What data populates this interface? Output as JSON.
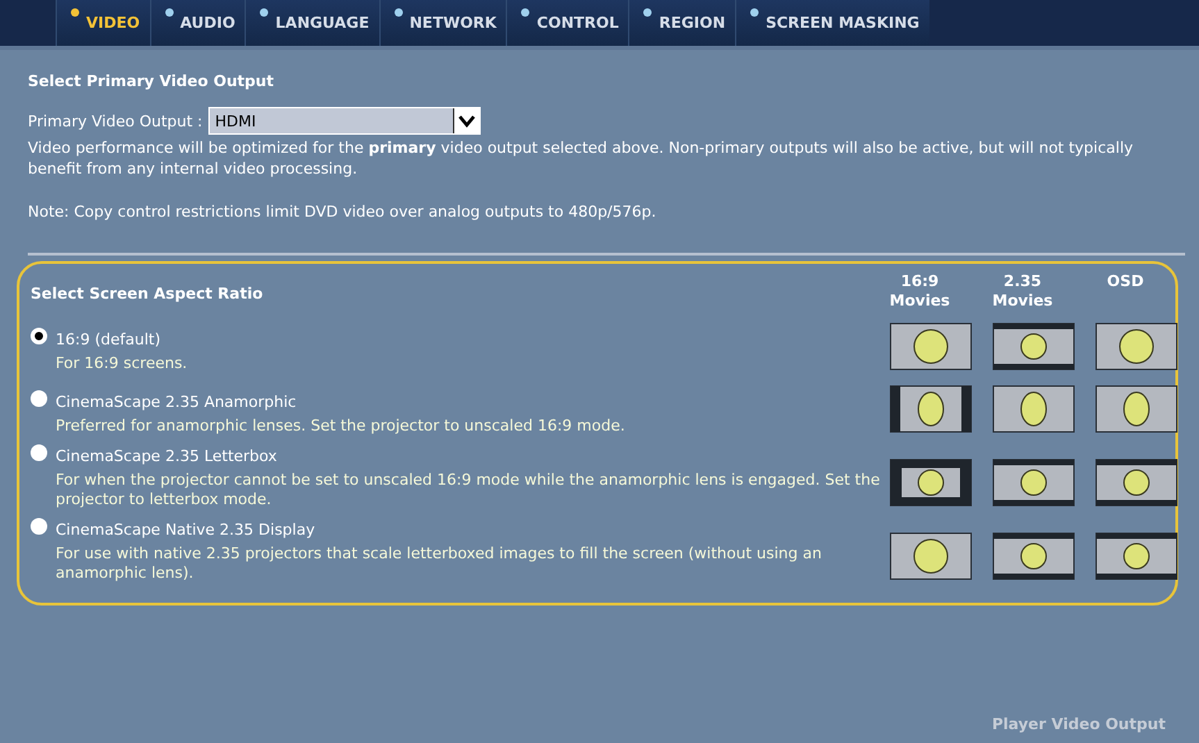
{
  "tabs": [
    {
      "label": "VIDEO",
      "selected": true
    },
    {
      "label": "AUDIO",
      "selected": false
    },
    {
      "label": "LANGUAGE",
      "selected": false
    },
    {
      "label": "NETWORK",
      "selected": false
    },
    {
      "label": "CONTROL",
      "selected": false
    },
    {
      "label": "REGION",
      "selected": false
    },
    {
      "label": "SCREEN MASKING",
      "selected": false
    }
  ],
  "primary": {
    "heading": "Select Primary Video Output",
    "label": "Primary Video Output :",
    "value": "HDMI",
    "description": "Video performance will be optimized for the **primary** video output selected above. Non-primary outputs will also be active, but will not typically benefit from any internal video processing.",
    "note": "Note: Copy control restrictions limit DVD video over analog outputs to 480p/576p."
  },
  "aspect": {
    "heading": "Select Screen Aspect Ratio",
    "columns": [
      {
        "line1": "16:9",
        "line2": "Movies"
      },
      {
        "line1": "2.35",
        "line2": "Movies"
      },
      {
        "line2": "OSD"
      }
    ],
    "options": [
      {
        "label": "16:9 (default)",
        "description": "For 16:9 screens.",
        "selected": true,
        "previews": [
          {
            "kind": "fullscreen"
          },
          {
            "kind": "letterbox"
          },
          {
            "kind": "fullscreen"
          }
        ]
      },
      {
        "label": "CinemaScape 2.35 Anamorphic",
        "description": "Preferred for anamorphic lenses. Set the projector to unscaled 16:9 mode.",
        "selected": false,
        "previews": [
          {
            "kind": "pillarbox"
          },
          {
            "kind": "anamorphic"
          },
          {
            "kind": "anamorphic"
          }
        ]
      },
      {
        "label": "CinemaScape 2.35 Letterbox",
        "description": "For when the projector cannot be set to unscaled 16:9 mode while the anamorphic lens is engaged. Set the projector to letterbox mode.",
        "selected": false,
        "previews": [
          {
            "kind": "windowbox"
          },
          {
            "kind": "letterbox"
          },
          {
            "kind": "letterbox"
          }
        ]
      },
      {
        "label": "CinemaScape Native 2.35 Display",
        "description": "For use with native 2.35 projectors that scale letterboxed images to fill the screen (without using an anamorphic lens).",
        "selected": false,
        "previews": [
          {
            "kind": "fullscreen"
          },
          {
            "kind": "letterbox"
          },
          {
            "kind": "letterbox"
          }
        ]
      }
    ],
    "footer": "Player Video Output"
  }
}
